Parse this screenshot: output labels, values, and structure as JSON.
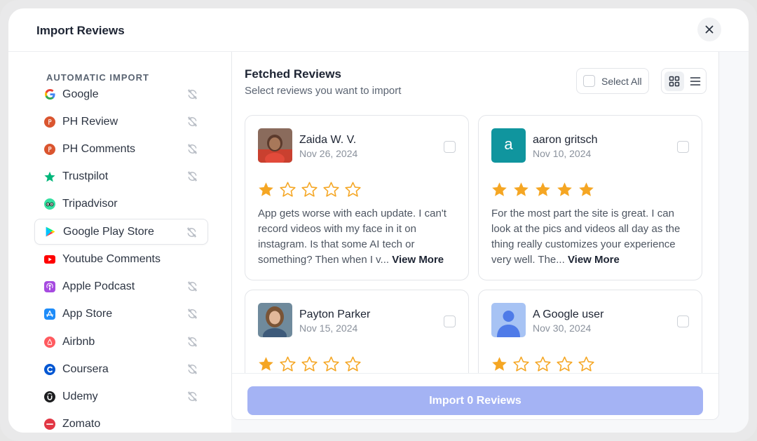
{
  "modal": {
    "title": "Import Reviews"
  },
  "sidebar": {
    "heading": "AUTOMATIC IMPORT",
    "items": [
      {
        "label": "Google",
        "icon": "google-icon",
        "sync": true
      },
      {
        "label": "PH Review",
        "icon": "producthunt-icon",
        "sync": true
      },
      {
        "label": "PH Comments",
        "icon": "producthunt-icon",
        "sync": true
      },
      {
        "label": "Trustpilot",
        "icon": "trustpilot-star-icon",
        "sync": true
      },
      {
        "label": "Tripadvisor",
        "icon": "tripadvisor-icon",
        "sync": false
      },
      {
        "label": "Google Play Store",
        "icon": "google-play-icon",
        "sync": true,
        "active": true
      },
      {
        "label": "Youtube Comments",
        "icon": "youtube-icon",
        "sync": false
      },
      {
        "label": "Apple Podcast",
        "icon": "apple-podcast-icon",
        "sync": true
      },
      {
        "label": "App Store",
        "icon": "app-store-icon",
        "sync": true
      },
      {
        "label": "Airbnb",
        "icon": "airbnb-icon",
        "sync": true
      },
      {
        "label": "Coursera",
        "icon": "coursera-icon",
        "sync": true
      },
      {
        "label": "Udemy",
        "icon": "udemy-icon",
        "sync": true
      },
      {
        "label": "Zomato",
        "icon": "zomato-icon",
        "sync": false
      }
    ]
  },
  "main": {
    "title": "Fetched Reviews",
    "subtitle": "Select reviews you want to import",
    "select_all": "Select All",
    "view_mode": "grid",
    "reviews": [
      {
        "name": "Zaida W. V.",
        "date": "Nov 26, 2024",
        "rating": 1,
        "text": "App gets worse with each update. I can't record videos with my face in it on instagram. Is that some AI tech or something? Then when I v...",
        "more": "View More",
        "avatar": "photo"
      },
      {
        "name": "aaron gritsch",
        "date": "Nov 10, 2024",
        "rating": 5,
        "text": "For the most part the site is great. I can look at the pics and videos all day as the thing really customizes your experience very well. The...",
        "more": "View More",
        "avatar": "letter",
        "avatar_letter": "a"
      },
      {
        "name": "Payton Parker",
        "date": "Nov 15, 2024",
        "rating": 1,
        "avatar": "photo"
      },
      {
        "name": "A Google user",
        "date": "Nov 30, 2024",
        "rating": 1,
        "avatar": "default"
      }
    ],
    "import_button": "Import 0 Reviews"
  },
  "colors": {
    "star_filled": "#f5a623",
    "import_button": "#a4b3f4",
    "avatar_teal": "#10959e"
  }
}
